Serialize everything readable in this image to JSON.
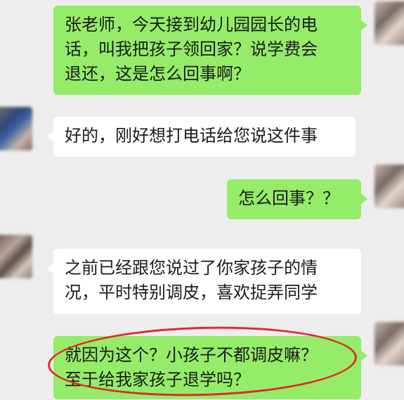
{
  "messages": [
    {
      "side": "right",
      "text": "张老师，今天接到幼儿园园长的电\n话，叫我把孩子领回家？说学费会\n退还，这是怎么回事啊？"
    },
    {
      "side": "left",
      "text": "好的，刚好想打电话给您说这件事"
    },
    {
      "side": "right",
      "text": "怎么回事？？"
    },
    {
      "side": "left",
      "text": "之前已经跟您说过了你家孩子的情\n况，平时特别调皮，喜欢捉弄同学"
    },
    {
      "side": "right",
      "text": "就因为这个？小孩子不都调皮嘛？\n至于给我家孩子退学吗？"
    }
  ],
  "colors": {
    "background": "#ededed",
    "outgoing_bubble": "#95ec69",
    "incoming_bubble": "#ffffff",
    "highlight_ellipse": "#e2272b"
  }
}
